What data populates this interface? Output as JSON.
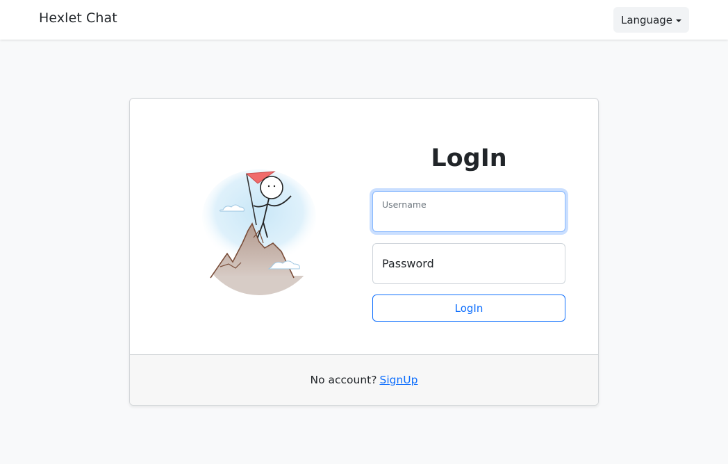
{
  "navbar": {
    "brand": "Hexlet Chat",
    "language_button": "Language"
  },
  "login": {
    "title": "LogIn",
    "username": {
      "label": "Username",
      "value": ""
    },
    "password": {
      "label": "Password",
      "value": ""
    },
    "submit_label": "LogIn"
  },
  "footer": {
    "prompt": "No account?",
    "signup_link": "SignUp"
  },
  "colors": {
    "accent": "#0d6efd",
    "page_bg": "#f8f9fa",
    "flag": "#f06b6b"
  },
  "icons": {
    "illustration": "climber-on-mountain-illustration",
    "dropdown": "caret-down-icon"
  }
}
